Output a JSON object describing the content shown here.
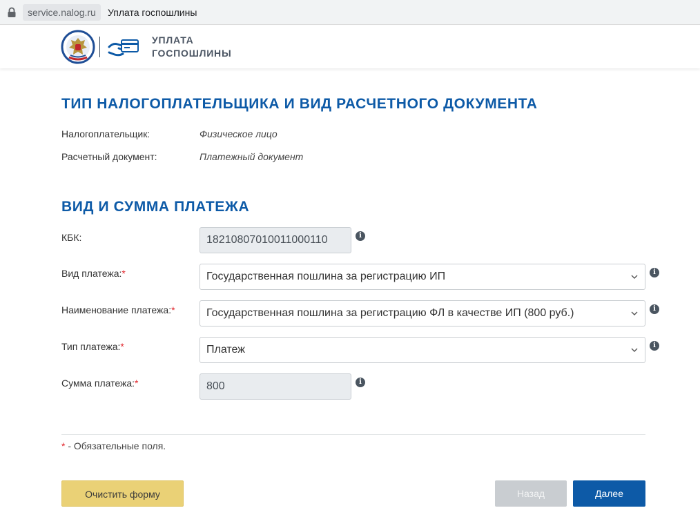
{
  "browser": {
    "url": "service.nalog.ru",
    "page_title": "Уплата госпошлины"
  },
  "header": {
    "service_line1": "УПЛАТА",
    "service_line2": "ГОСПОШЛИНЫ",
    "emblem_icon": "fns-emblem-icon",
    "card_icon": "hand-card-icon"
  },
  "section1": {
    "title": "ТИП НАЛОГОПЛАТЕЛЬЩИКА И ВИД РАСЧЕТНОГО ДОКУМЕНТА",
    "taxpayer_label": "Налогоплательщик:",
    "taxpayer_value": "Физическое лицо",
    "document_label": "Расчетный документ:",
    "document_value": "Платежный документ"
  },
  "section2": {
    "title": "ВИД И СУММА ПЛАТЕЖА",
    "kbk_label": "КБК:",
    "kbk_value": "18210807010011000110",
    "payment_kind_label": "Вид платежа:",
    "payment_kind_value": "Государственная пошлина за регистрацию ИП",
    "payment_name_label": "Наименование платежа:",
    "payment_name_value": "Государственная пошлина за регистрацию ФЛ в качестве ИП (800 руб.)",
    "payment_type_label": "Тип платежа:",
    "payment_type_value": "Платеж",
    "amount_label": "Сумма платежа:",
    "amount_value": "800",
    "required_mark": "*"
  },
  "footer": {
    "required_note_mark": "*",
    "required_note_text": " - Обязательные поля.",
    "clear_button": "Очистить форму",
    "back_button": "Назад",
    "next_button": "Далее"
  },
  "colors": {
    "accent": "#0d5aa7",
    "required": "#e1262c",
    "clear_button": "#ead176",
    "disabled_button": "#c9cdd1"
  }
}
